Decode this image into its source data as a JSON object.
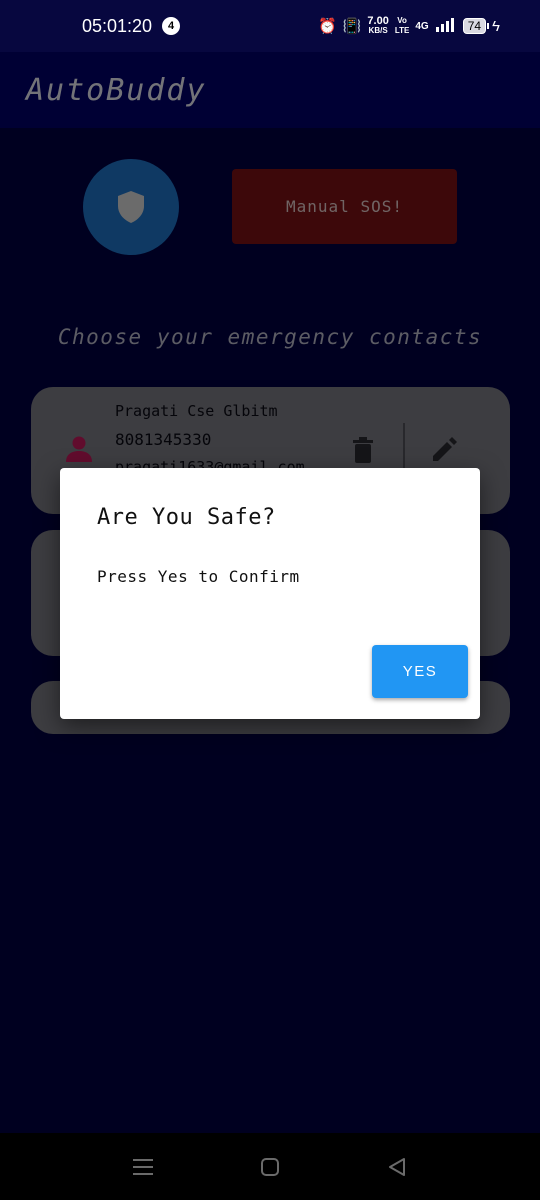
{
  "status_bar": {
    "time": "05:01:20",
    "notification_count": "4",
    "net_speed": "7.00",
    "net_speed_unit": "KB/S",
    "volte_top": "Vo",
    "volte_bottom": "LTE",
    "network": "4G",
    "battery": "74"
  },
  "app_bar": {
    "title": "AutoBuddy"
  },
  "main": {
    "sos_label": "Manual SOS!",
    "section_title": "Choose your emergency contacts",
    "contacts": [
      {
        "name": "Pragati Cse Glbitm",
        "phone": "8081345330",
        "email": "pragati1633@gmail.com"
      }
    ]
  },
  "dialog": {
    "title": "Are You Safe?",
    "message": "Press Yes to Confirm",
    "yes_label": "YES"
  },
  "colors": {
    "background": "#000041",
    "app_bar": "#000069",
    "shield_button": "#1e73c6",
    "sos_button": "#7a1014",
    "accent": "#2196f3",
    "contact_icon": "#c2185b"
  }
}
